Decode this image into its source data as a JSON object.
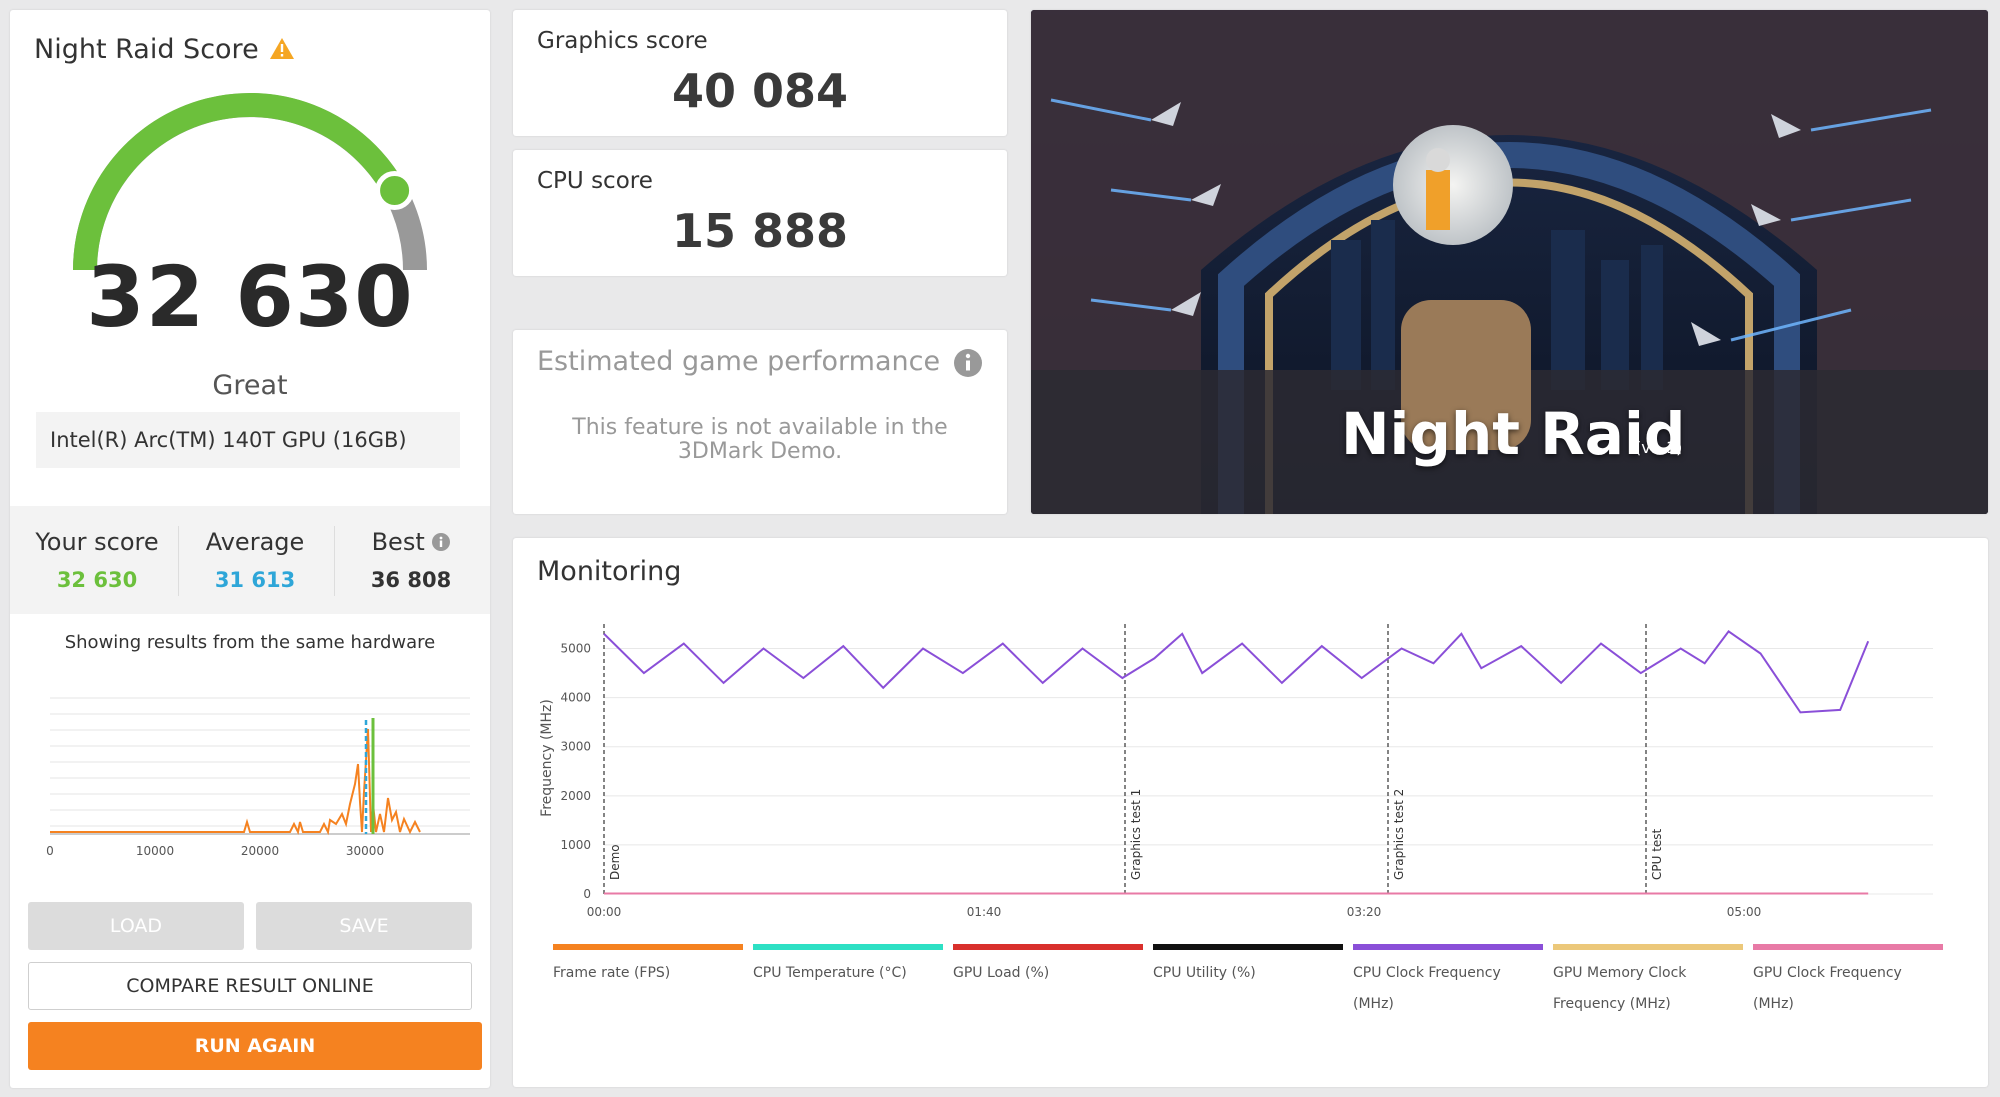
{
  "score_card": {
    "title": "Night Raid Score",
    "score": "32 630",
    "rating": "Great",
    "gauge_fraction": 0.84,
    "gpu": "Intel(R) Arc(TM) 140T GPU (16GB)",
    "stats": {
      "your_label": "Your score",
      "your_value": "32 630",
      "avg_label": "Average",
      "avg_value": "31 613",
      "best_label": "Best",
      "best_value": "36 808"
    },
    "same_hardware": "Showing results from the same hardware",
    "dist_ticks": [
      "0",
      "10000",
      "20000",
      "30000"
    ],
    "buttons": {
      "load": "LOAD",
      "save": "SAVE",
      "compare": "COMPARE RESULT ONLINE",
      "run": "RUN AGAIN"
    }
  },
  "graphics": {
    "label": "Graphics score",
    "value": "40 084"
  },
  "cpu": {
    "label": "CPU score",
    "value": "15 888"
  },
  "egp": {
    "title": "Estimated game performance",
    "msg_line1": "This feature is not available in the",
    "msg_line2": "3DMark Demo."
  },
  "hero": {
    "title": "Night Raid",
    "version": "(v1.1)"
  },
  "monitoring": {
    "title": "Monitoring",
    "y_label": "Frequency (MHz)",
    "y_ticks": [
      "0",
      "1000",
      "2000",
      "3000",
      "4000",
      "5000"
    ],
    "x_ticks": [
      "00:00",
      "01:40",
      "03:20",
      "05:00"
    ],
    "markers": [
      "Demo",
      "Graphics test 1",
      "Graphics test 2",
      "CPU test"
    ],
    "legend": [
      {
        "label": "Frame rate (FPS)",
        "color": "#f58220"
      },
      {
        "label": "CPU Temperature (°C)",
        "color": "#2de0c4"
      },
      {
        "label": "GPU Load (%)",
        "color": "#d9302c"
      },
      {
        "label": "CPU Utility (%)",
        "color": "#111111"
      },
      {
        "label": "CPU Clock Frequency (MHz)",
        "color": "#8a4fd8"
      },
      {
        "label": "GPU Memory Clock Frequency (MHz)",
        "color": "#ecc87a"
      },
      {
        "label": "GPU Clock Frequency (MHz)",
        "color": "#e87aa6"
      }
    ]
  },
  "colors": {
    "accent": "#f58220",
    "score_green": "#6cc03c",
    "average_blue": "#2ea6d8",
    "cpu_line": "#8a4fd8",
    "gpu_line": "#e87aa6"
  },
  "chart_data": {
    "type": "line",
    "ylabel": "Frequency (MHz)",
    "ylim": [
      0,
      5500
    ],
    "x_ticks": [
      "00:00",
      "01:40",
      "03:20",
      "05:00"
    ],
    "series": [
      {
        "name": "CPU Clock Frequency (MHz)",
        "x": [
          0,
          10,
          20,
          30,
          40,
          50,
          60,
          70,
          80,
          90,
          100,
          110,
          120,
          130,
          138,
          145,
          150,
          160,
          170,
          180,
          190,
          200,
          208,
          215,
          220,
          230,
          240,
          250,
          260,
          270,
          276,
          282,
          290,
          300,
          310,
          317
        ],
        "values": [
          5300,
          4500,
          5100,
          4300,
          5000,
          4400,
          5050,
          4200,
          5000,
          4500,
          5100,
          4300,
          5000,
          4400,
          4800,
          5300,
          4500,
          5100,
          4300,
          5050,
          4400,
          5000,
          4700,
          5300,
          4600,
          5050,
          4300,
          5100,
          4500,
          5000,
          4700,
          5350,
          4900,
          3700,
          3750,
          5150
        ]
      },
      {
        "name": "GPU Clock Frequency (MHz)",
        "x": [
          0,
          317
        ],
        "values": [
          10,
          10
        ]
      }
    ]
  }
}
